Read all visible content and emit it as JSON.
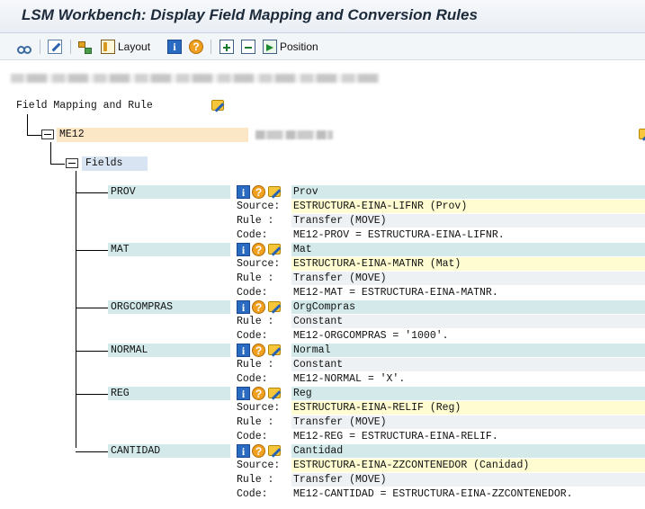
{
  "window": {
    "title": "LSM Workbench: Display Field Mapping and Conversion Rules"
  },
  "toolbar": {
    "layout_label": "Layout",
    "position_label": "Position"
  },
  "tree": {
    "root_label": "Field Mapping and Rule",
    "structure_name": "ME12",
    "fields_label": "Fields",
    "labels": {
      "source": "Source:",
      "rule": "Rule :",
      "code": "Code:"
    },
    "fields": [
      {
        "name": "PROV",
        "description": "Prov",
        "source": "ESTRUCTURA-EINA-LIFNR (Prov)",
        "rule": "Transfer (MOVE)",
        "code": "ME12-PROV = ESTRUCTURA-EINA-LIFNR."
      },
      {
        "name": "MAT",
        "description": "Mat",
        "source": "ESTRUCTURA-EINA-MATNR (Mat)",
        "rule": "Transfer (MOVE)",
        "code": "ME12-MAT = ESTRUCTURA-EINA-MATNR."
      },
      {
        "name": "ORGCOMPRAS",
        "description": "OrgCompras",
        "rule": "Constant",
        "code": "ME12-ORGCOMPRAS = '1000'."
      },
      {
        "name": "NORMAL",
        "description": "Normal",
        "rule": "Constant",
        "code": "ME12-NORMAL = 'X'."
      },
      {
        "name": "REG",
        "description": "Reg",
        "source": "ESTRUCTURA-EINA-RELIF (Reg)",
        "rule": "Transfer (MOVE)",
        "code": "ME12-REG = ESTRUCTURA-EINA-RELIF."
      },
      {
        "name": "CANTIDAD",
        "description": "Cantidad",
        "source": "ESTRUCTURA-EINA-ZZCONTENEDOR (Canidad)",
        "rule": "Transfer (MOVE)",
        "code": "ME12-CANTIDAD = ESTRUCTURA-EINA-ZZCONTENEDOR."
      }
    ]
  },
  "colors": {
    "structure_band": "#fbe6c6",
    "fields_band": "#d9e4f2",
    "field_name_band": "#d3e9ea",
    "source_band": "#fefcd0"
  },
  "icons": [
    "glasses-icon",
    "edit-icon",
    "tree-icon",
    "layout-icon",
    "info-icon",
    "help-icon",
    "expand-all-icon",
    "collapse-all-icon",
    "position-icon",
    "pencil-icon",
    "folder-icon"
  ]
}
